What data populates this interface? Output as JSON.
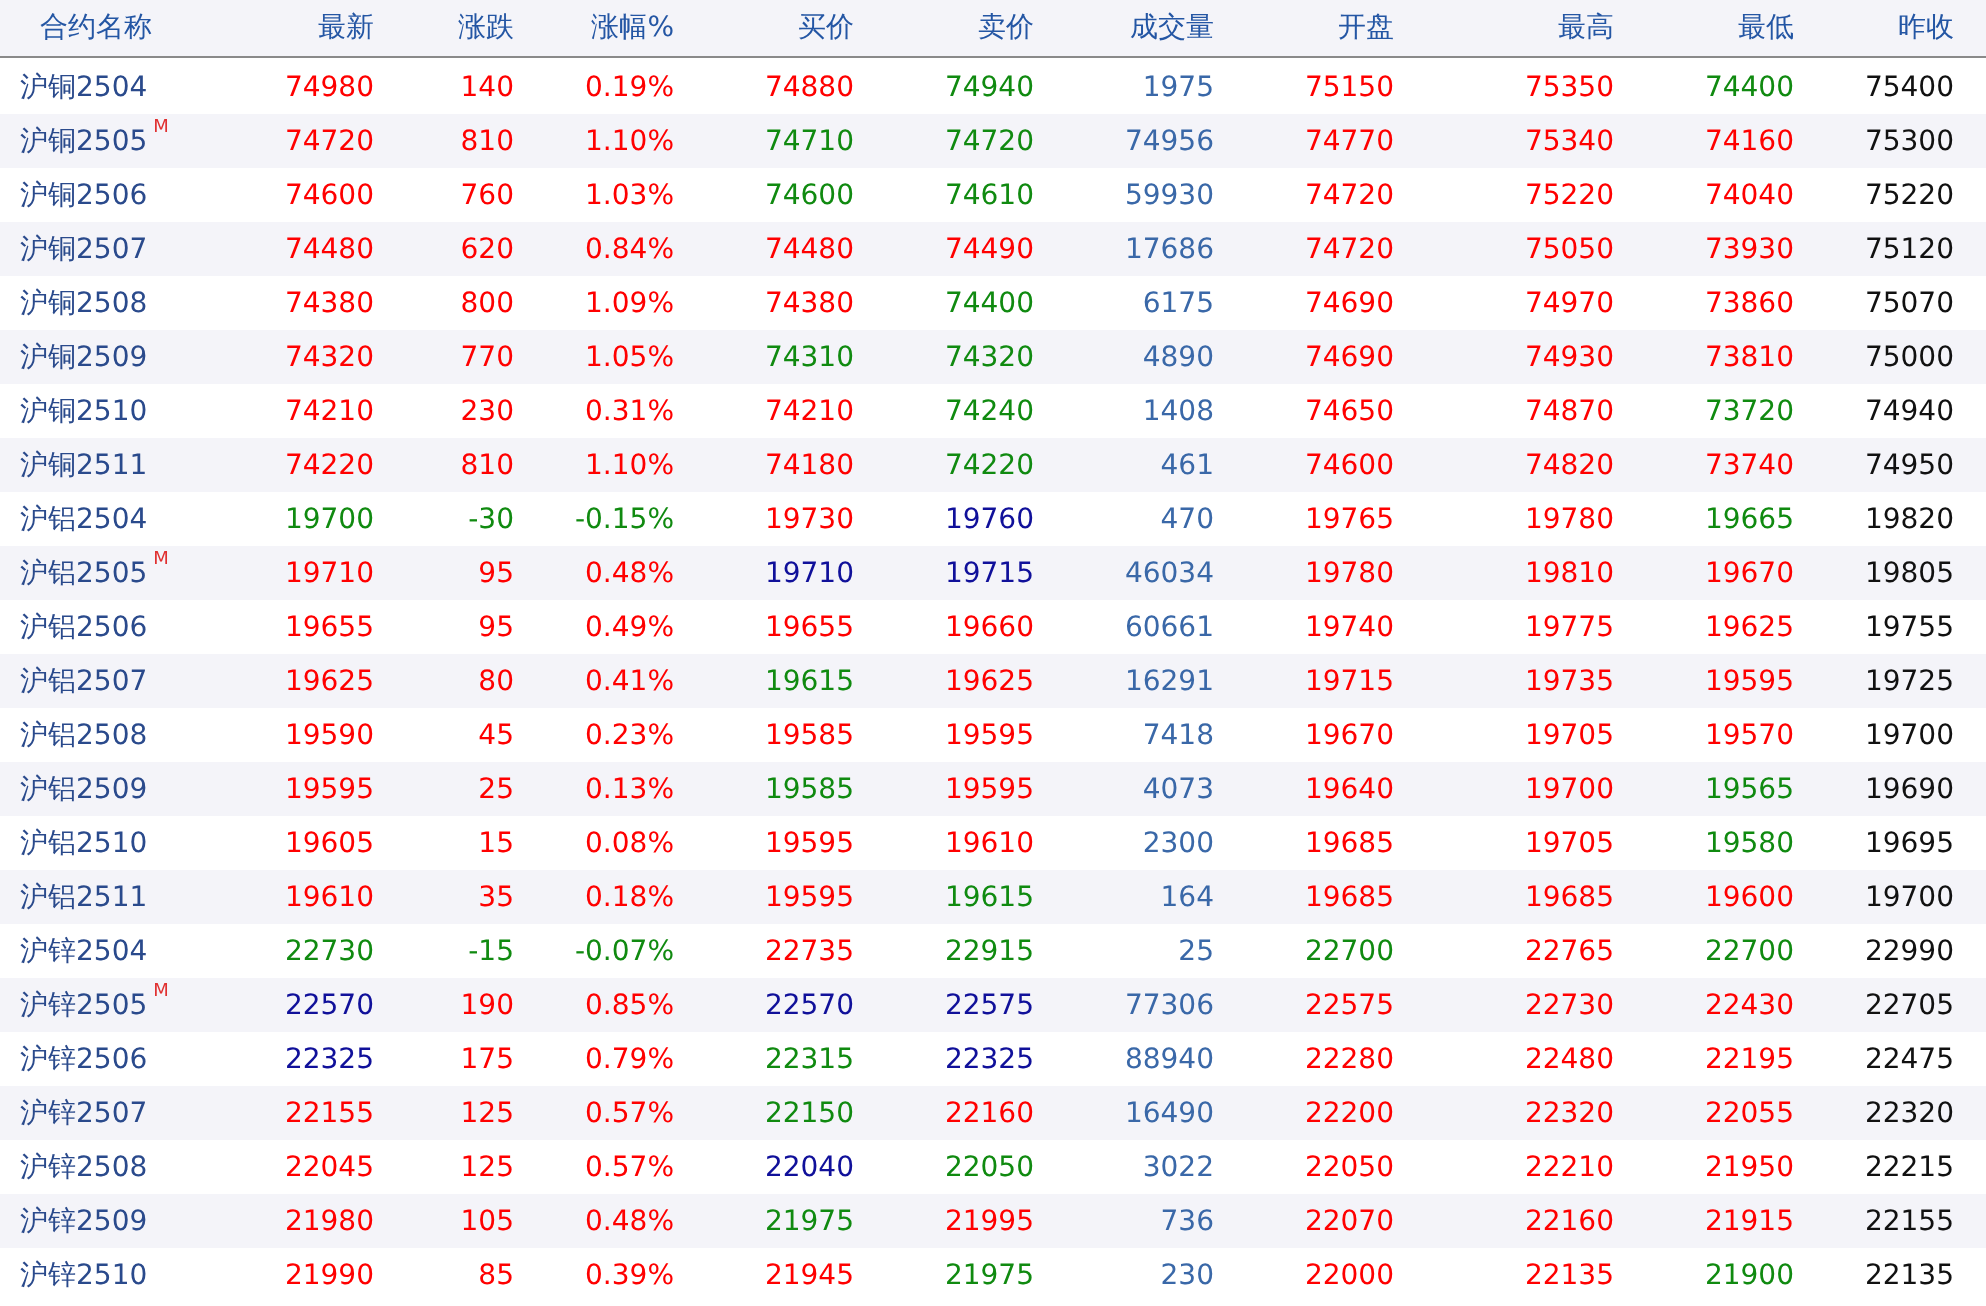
{
  "table": {
    "columns": [
      "合约名称",
      "最新",
      "涨跌",
      "涨幅%",
      "买价",
      "卖价",
      "成交量",
      "开盘",
      "最高",
      "最低",
      "昨收"
    ],
    "rows": [
      {
        "cells": [
          {
            "text": "沪铜2504"
          },
          {
            "text": "74980",
            "color": "#ff0000"
          },
          {
            "text": "140",
            "color": "#ff0000"
          },
          {
            "text": "0.19%",
            "color": "#ff0000"
          },
          {
            "text": "74880",
            "color": "#ff0000"
          },
          {
            "text": "74940",
            "color": "#108a10"
          },
          {
            "text": "1975"
          },
          {
            "text": "75150",
            "color": "#ff0000"
          },
          {
            "text": "75350",
            "color": "#ff0000"
          },
          {
            "text": "74400",
            "color": "#108a10"
          },
          {
            "text": "75400"
          }
        ]
      },
      {
        "cells": [
          {
            "text": "沪铜2505",
            "badge": "M"
          },
          {
            "text": "74720",
            "color": "#ff0000"
          },
          {
            "text": "810",
            "color": "#ff0000"
          },
          {
            "text": "1.10%",
            "color": "#ff0000"
          },
          {
            "text": "74710",
            "color": "#108a10"
          },
          {
            "text": "74720",
            "color": "#108a10"
          },
          {
            "text": "74956"
          },
          {
            "text": "74770",
            "color": "#ff0000"
          },
          {
            "text": "75340",
            "color": "#ff0000"
          },
          {
            "text": "74160",
            "color": "#ff0000"
          },
          {
            "text": "75300"
          }
        ]
      },
      {
        "cells": [
          {
            "text": "沪铜2506"
          },
          {
            "text": "74600",
            "color": "#ff0000"
          },
          {
            "text": "760",
            "color": "#ff0000"
          },
          {
            "text": "1.03%",
            "color": "#ff0000"
          },
          {
            "text": "74600",
            "color": "#108a10"
          },
          {
            "text": "74610",
            "color": "#108a10"
          },
          {
            "text": "59930"
          },
          {
            "text": "74720",
            "color": "#ff0000"
          },
          {
            "text": "75220",
            "color": "#ff0000"
          },
          {
            "text": "74040",
            "color": "#ff0000"
          },
          {
            "text": "75220"
          }
        ]
      },
      {
        "cells": [
          {
            "text": "沪铜2507"
          },
          {
            "text": "74480",
            "color": "#ff0000"
          },
          {
            "text": "620",
            "color": "#ff0000"
          },
          {
            "text": "0.84%",
            "color": "#ff0000"
          },
          {
            "text": "74480",
            "color": "#ff0000"
          },
          {
            "text": "74490",
            "color": "#ff0000"
          },
          {
            "text": "17686"
          },
          {
            "text": "74720",
            "color": "#ff0000"
          },
          {
            "text": "75050",
            "color": "#ff0000"
          },
          {
            "text": "73930",
            "color": "#ff0000"
          },
          {
            "text": "75120"
          }
        ]
      },
      {
        "cells": [
          {
            "text": "沪铜2508"
          },
          {
            "text": "74380",
            "color": "#ff0000"
          },
          {
            "text": "800",
            "color": "#ff0000"
          },
          {
            "text": "1.09%",
            "color": "#ff0000"
          },
          {
            "text": "74380",
            "color": "#ff0000"
          },
          {
            "text": "74400",
            "color": "#108a10"
          },
          {
            "text": "6175"
          },
          {
            "text": "74690",
            "color": "#ff0000"
          },
          {
            "text": "74970",
            "color": "#ff0000"
          },
          {
            "text": "73860",
            "color": "#ff0000"
          },
          {
            "text": "75070"
          }
        ]
      },
      {
        "cells": [
          {
            "text": "沪铜2509"
          },
          {
            "text": "74320",
            "color": "#ff0000"
          },
          {
            "text": "770",
            "color": "#ff0000"
          },
          {
            "text": "1.05%",
            "color": "#ff0000"
          },
          {
            "text": "74310",
            "color": "#108a10"
          },
          {
            "text": "74320",
            "color": "#108a10"
          },
          {
            "text": "4890"
          },
          {
            "text": "74690",
            "color": "#ff0000"
          },
          {
            "text": "74930",
            "color": "#ff0000"
          },
          {
            "text": "73810",
            "color": "#ff0000"
          },
          {
            "text": "75000"
          }
        ]
      },
      {
        "cells": [
          {
            "text": "沪铜2510"
          },
          {
            "text": "74210",
            "color": "#ff0000"
          },
          {
            "text": "230",
            "color": "#ff0000"
          },
          {
            "text": "0.31%",
            "color": "#ff0000"
          },
          {
            "text": "74210",
            "color": "#ff0000"
          },
          {
            "text": "74240",
            "color": "#108a10"
          },
          {
            "text": "1408"
          },
          {
            "text": "74650",
            "color": "#ff0000"
          },
          {
            "text": "74870",
            "color": "#ff0000"
          },
          {
            "text": "73720",
            "color": "#108a10"
          },
          {
            "text": "74940"
          }
        ]
      },
      {
        "cells": [
          {
            "text": "沪铜2511"
          },
          {
            "text": "74220",
            "color": "#ff0000"
          },
          {
            "text": "810",
            "color": "#ff0000"
          },
          {
            "text": "1.10%",
            "color": "#ff0000"
          },
          {
            "text": "74180",
            "color": "#ff0000"
          },
          {
            "text": "74220",
            "color": "#108a10"
          },
          {
            "text": "461"
          },
          {
            "text": "74600",
            "color": "#ff0000"
          },
          {
            "text": "74820",
            "color": "#ff0000"
          },
          {
            "text": "73740",
            "color": "#ff0000"
          },
          {
            "text": "74950"
          }
        ]
      },
      {
        "cells": [
          {
            "text": "沪铝2504"
          },
          {
            "text": "19700",
            "color": "#108a10"
          },
          {
            "text": "-30",
            "color": "#108a10"
          },
          {
            "text": "-0.15%",
            "color": "#108a10"
          },
          {
            "text": "19730",
            "color": "#ff0000"
          },
          {
            "text": "19760",
            "color": "#10109a"
          },
          {
            "text": "470"
          },
          {
            "text": "19765",
            "color": "#ff0000"
          },
          {
            "text": "19780",
            "color": "#ff0000"
          },
          {
            "text": "19665",
            "color": "#108a10"
          },
          {
            "text": "19820"
          }
        ]
      },
      {
        "cells": [
          {
            "text": "沪铝2505",
            "badge": "M"
          },
          {
            "text": "19710",
            "color": "#ff0000"
          },
          {
            "text": "95",
            "color": "#ff0000"
          },
          {
            "text": "0.48%",
            "color": "#ff0000"
          },
          {
            "text": "19710",
            "color": "#10109a"
          },
          {
            "text": "19715",
            "color": "#10109a"
          },
          {
            "text": "46034"
          },
          {
            "text": "19780",
            "color": "#ff0000"
          },
          {
            "text": "19810",
            "color": "#ff0000"
          },
          {
            "text": "19670",
            "color": "#ff0000"
          },
          {
            "text": "19805"
          }
        ]
      },
      {
        "cells": [
          {
            "text": "沪铝2506"
          },
          {
            "text": "19655",
            "color": "#ff0000"
          },
          {
            "text": "95",
            "color": "#ff0000"
          },
          {
            "text": "0.49%",
            "color": "#ff0000"
          },
          {
            "text": "19655",
            "color": "#ff0000"
          },
          {
            "text": "19660",
            "color": "#ff0000"
          },
          {
            "text": "60661"
          },
          {
            "text": "19740",
            "color": "#ff0000"
          },
          {
            "text": "19775",
            "color": "#ff0000"
          },
          {
            "text": "19625",
            "color": "#ff0000"
          },
          {
            "text": "19755"
          }
        ]
      },
      {
        "cells": [
          {
            "text": "沪铝2507"
          },
          {
            "text": "19625",
            "color": "#ff0000"
          },
          {
            "text": "80",
            "color": "#ff0000"
          },
          {
            "text": "0.41%",
            "color": "#ff0000"
          },
          {
            "text": "19615",
            "color": "#108a10"
          },
          {
            "text": "19625",
            "color": "#ff0000"
          },
          {
            "text": "16291"
          },
          {
            "text": "19715",
            "color": "#ff0000"
          },
          {
            "text": "19735",
            "color": "#ff0000"
          },
          {
            "text": "19595",
            "color": "#ff0000"
          },
          {
            "text": "19725"
          }
        ]
      },
      {
        "cells": [
          {
            "text": "沪铝2508"
          },
          {
            "text": "19590",
            "color": "#ff0000"
          },
          {
            "text": "45",
            "color": "#ff0000"
          },
          {
            "text": "0.23%",
            "color": "#ff0000"
          },
          {
            "text": "19585",
            "color": "#ff0000"
          },
          {
            "text": "19595",
            "color": "#ff0000"
          },
          {
            "text": "7418"
          },
          {
            "text": "19670",
            "color": "#ff0000"
          },
          {
            "text": "19705",
            "color": "#ff0000"
          },
          {
            "text": "19570",
            "color": "#ff0000"
          },
          {
            "text": "19700"
          }
        ]
      },
      {
        "cells": [
          {
            "text": "沪铝2509"
          },
          {
            "text": "19595",
            "color": "#ff0000"
          },
          {
            "text": "25",
            "color": "#ff0000"
          },
          {
            "text": "0.13%",
            "color": "#ff0000"
          },
          {
            "text": "19585",
            "color": "#108a10"
          },
          {
            "text": "19595",
            "color": "#ff0000"
          },
          {
            "text": "4073"
          },
          {
            "text": "19640",
            "color": "#ff0000"
          },
          {
            "text": "19700",
            "color": "#ff0000"
          },
          {
            "text": "19565",
            "color": "#108a10"
          },
          {
            "text": "19690"
          }
        ]
      },
      {
        "cells": [
          {
            "text": "沪铝2510"
          },
          {
            "text": "19605",
            "color": "#ff0000"
          },
          {
            "text": "15",
            "color": "#ff0000"
          },
          {
            "text": "0.08%",
            "color": "#ff0000"
          },
          {
            "text": "19595",
            "color": "#ff0000"
          },
          {
            "text": "19610",
            "color": "#ff0000"
          },
          {
            "text": "2300"
          },
          {
            "text": "19685",
            "color": "#ff0000"
          },
          {
            "text": "19705",
            "color": "#ff0000"
          },
          {
            "text": "19580",
            "color": "#108a10"
          },
          {
            "text": "19695"
          }
        ]
      },
      {
        "cells": [
          {
            "text": "沪铝2511"
          },
          {
            "text": "19610",
            "color": "#ff0000"
          },
          {
            "text": "35",
            "color": "#ff0000"
          },
          {
            "text": "0.18%",
            "color": "#ff0000"
          },
          {
            "text": "19595",
            "color": "#ff0000"
          },
          {
            "text": "19615",
            "color": "#108a10"
          },
          {
            "text": "164"
          },
          {
            "text": "19685",
            "color": "#ff0000"
          },
          {
            "text": "19685",
            "color": "#ff0000"
          },
          {
            "text": "19600",
            "color": "#ff0000"
          },
          {
            "text": "19700"
          }
        ]
      },
      {
        "cells": [
          {
            "text": "沪锌2504"
          },
          {
            "text": "22730",
            "color": "#108a10"
          },
          {
            "text": "-15",
            "color": "#108a10"
          },
          {
            "text": "-0.07%",
            "color": "#108a10"
          },
          {
            "text": "22735",
            "color": "#ff0000"
          },
          {
            "text": "22915",
            "color": "#108a10"
          },
          {
            "text": "25"
          },
          {
            "text": "22700",
            "color": "#108a10"
          },
          {
            "text": "22765",
            "color": "#ff0000"
          },
          {
            "text": "22700",
            "color": "#108a10"
          },
          {
            "text": "22990"
          }
        ]
      },
      {
        "cells": [
          {
            "text": "沪锌2505",
            "badge": "M"
          },
          {
            "text": "22570",
            "color": "#10109a"
          },
          {
            "text": "190",
            "color": "#ff0000"
          },
          {
            "text": "0.85%",
            "color": "#ff0000"
          },
          {
            "text": "22570",
            "color": "#10109a"
          },
          {
            "text": "22575",
            "color": "#10109a"
          },
          {
            "text": "77306"
          },
          {
            "text": "22575",
            "color": "#ff0000"
          },
          {
            "text": "22730",
            "color": "#ff0000"
          },
          {
            "text": "22430",
            "color": "#ff0000"
          },
          {
            "text": "22705"
          }
        ]
      },
      {
        "cells": [
          {
            "text": "沪锌2506"
          },
          {
            "text": "22325",
            "color": "#10109a"
          },
          {
            "text": "175",
            "color": "#ff0000"
          },
          {
            "text": "0.79%",
            "color": "#ff0000"
          },
          {
            "text": "22315",
            "color": "#108a10"
          },
          {
            "text": "22325",
            "color": "#10109a"
          },
          {
            "text": "88940"
          },
          {
            "text": "22280",
            "color": "#ff0000"
          },
          {
            "text": "22480",
            "color": "#ff0000"
          },
          {
            "text": "22195",
            "color": "#ff0000"
          },
          {
            "text": "22475"
          }
        ]
      },
      {
        "cells": [
          {
            "text": "沪锌2507"
          },
          {
            "text": "22155",
            "color": "#ff0000"
          },
          {
            "text": "125",
            "color": "#ff0000"
          },
          {
            "text": "0.57%",
            "color": "#ff0000"
          },
          {
            "text": "22150",
            "color": "#108a10"
          },
          {
            "text": "22160",
            "color": "#ff0000"
          },
          {
            "text": "16490"
          },
          {
            "text": "22200",
            "color": "#ff0000"
          },
          {
            "text": "22320",
            "color": "#ff0000"
          },
          {
            "text": "22055",
            "color": "#ff0000"
          },
          {
            "text": "22320"
          }
        ]
      },
      {
        "cells": [
          {
            "text": "沪锌2508"
          },
          {
            "text": "22045",
            "color": "#ff0000"
          },
          {
            "text": "125",
            "color": "#ff0000"
          },
          {
            "text": "0.57%",
            "color": "#ff0000"
          },
          {
            "text": "22040",
            "color": "#10109a"
          },
          {
            "text": "22050",
            "color": "#108a10"
          },
          {
            "text": "3022"
          },
          {
            "text": "22050",
            "color": "#ff0000"
          },
          {
            "text": "22210",
            "color": "#ff0000"
          },
          {
            "text": "21950",
            "color": "#ff0000"
          },
          {
            "text": "22215"
          }
        ]
      },
      {
        "cells": [
          {
            "text": "沪锌2509"
          },
          {
            "text": "21980",
            "color": "#ff0000"
          },
          {
            "text": "105",
            "color": "#ff0000"
          },
          {
            "text": "0.48%",
            "color": "#ff0000"
          },
          {
            "text": "21975",
            "color": "#108a10"
          },
          {
            "text": "21995",
            "color": "#ff0000"
          },
          {
            "text": "736"
          },
          {
            "text": "22070",
            "color": "#ff0000"
          },
          {
            "text": "22160",
            "color": "#ff0000"
          },
          {
            "text": "21915",
            "color": "#ff0000"
          },
          {
            "text": "22155"
          }
        ]
      },
      {
        "cells": [
          {
            "text": "沪锌2510"
          },
          {
            "text": "21990",
            "color": "#ff0000"
          },
          {
            "text": "85",
            "color": "#ff0000"
          },
          {
            "text": "0.39%",
            "color": "#ff0000"
          },
          {
            "text": "21945",
            "color": "#ff0000"
          },
          {
            "text": "21975",
            "color": "#108a10"
          },
          {
            "text": "230"
          },
          {
            "text": "22000",
            "color": "#ff0000"
          },
          {
            "text": "22135",
            "color": "#ff0000"
          },
          {
            "text": "21900",
            "color": "#108a10"
          },
          {
            "text": "22135"
          }
        ]
      }
    ]
  }
}
